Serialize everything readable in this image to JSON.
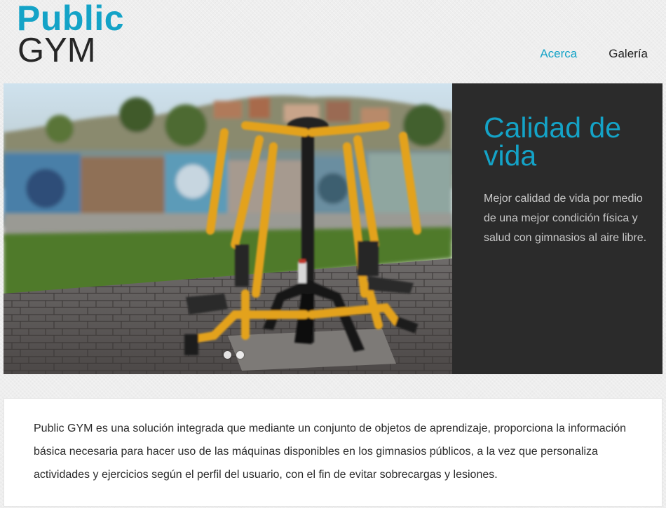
{
  "brand": {
    "line1": "Public",
    "line2": "GYM"
  },
  "nav": {
    "items": [
      {
        "label": "Acerca",
        "active": true
      },
      {
        "label": "Galería",
        "active": false
      }
    ]
  },
  "hero": {
    "title": "Calidad de vida",
    "text": "Mejor calidad de vida por medio de una mejor condición física y salud con gimnasios al aire libre.",
    "slide_count": 2
  },
  "about": {
    "text": "Public GYM es una solución integrada que mediante un conjunto de objetos de aprendizaje, proporciona la información básica necesaria para hacer uso de las máquinas disponibles en los gimnasios públicos, a la vez que personaliza actividades y ejercicios según el perfil del usuario, con el fin de evitar sobrecargas y lesiones."
  },
  "colors": {
    "accent": "#14a3c7",
    "dark_panel": "#2b2b2b",
    "machine_yellow": "#e3a21f"
  }
}
